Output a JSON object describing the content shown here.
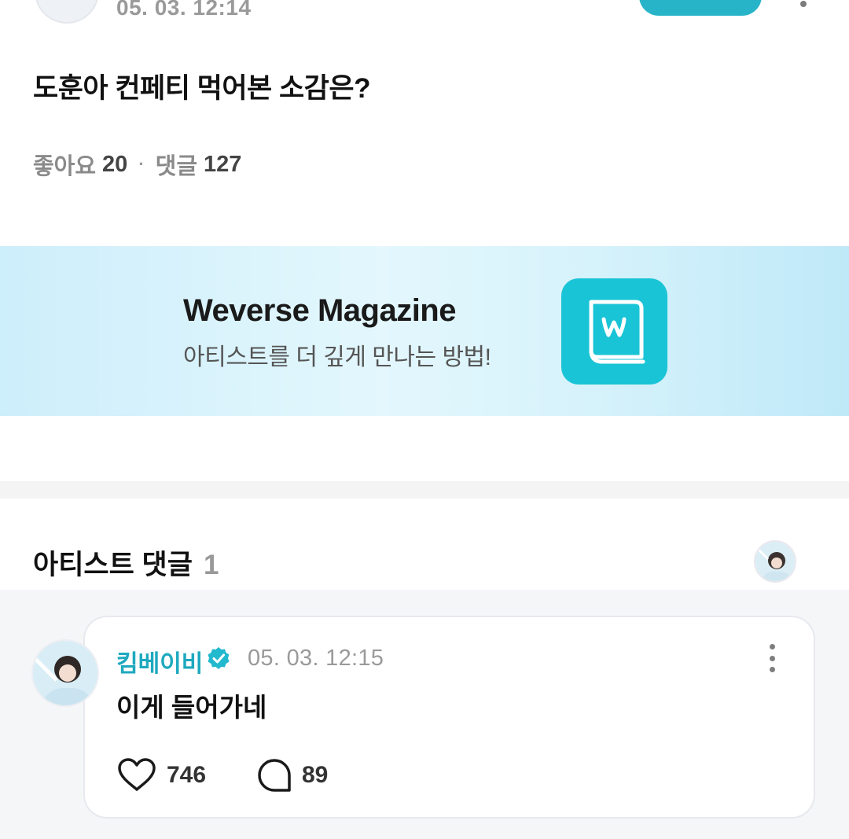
{
  "post": {
    "date": "05. 03. 12:14",
    "title": "도훈아 컨페티 먹어본 소감은?",
    "stats": {
      "likes_label": "좋아요",
      "likes_count": "20",
      "separator": "·",
      "comments_label": "댓글",
      "comments_count": "127"
    },
    "avatar_icon": "user-avatar",
    "more_icon": "more-dots-icon"
  },
  "banner": {
    "title": "Weverse Magazine",
    "subtitle": "아티스트를 더 깊게 만나는 방법!",
    "icon": "weverse-book-icon",
    "accent_color": "#19c4d6"
  },
  "artist_comments": {
    "heading": "아티스트 댓글",
    "count": "1",
    "comment": {
      "author": "킴베이비",
      "verified": true,
      "date": "05. 03. 12:15",
      "text": "이게 들어가네",
      "likes": "746",
      "replies": "89"
    }
  },
  "colors": {
    "accent": "#28b4c8",
    "author_name": "#1ea9bf",
    "muted": "#9a9a9a"
  }
}
